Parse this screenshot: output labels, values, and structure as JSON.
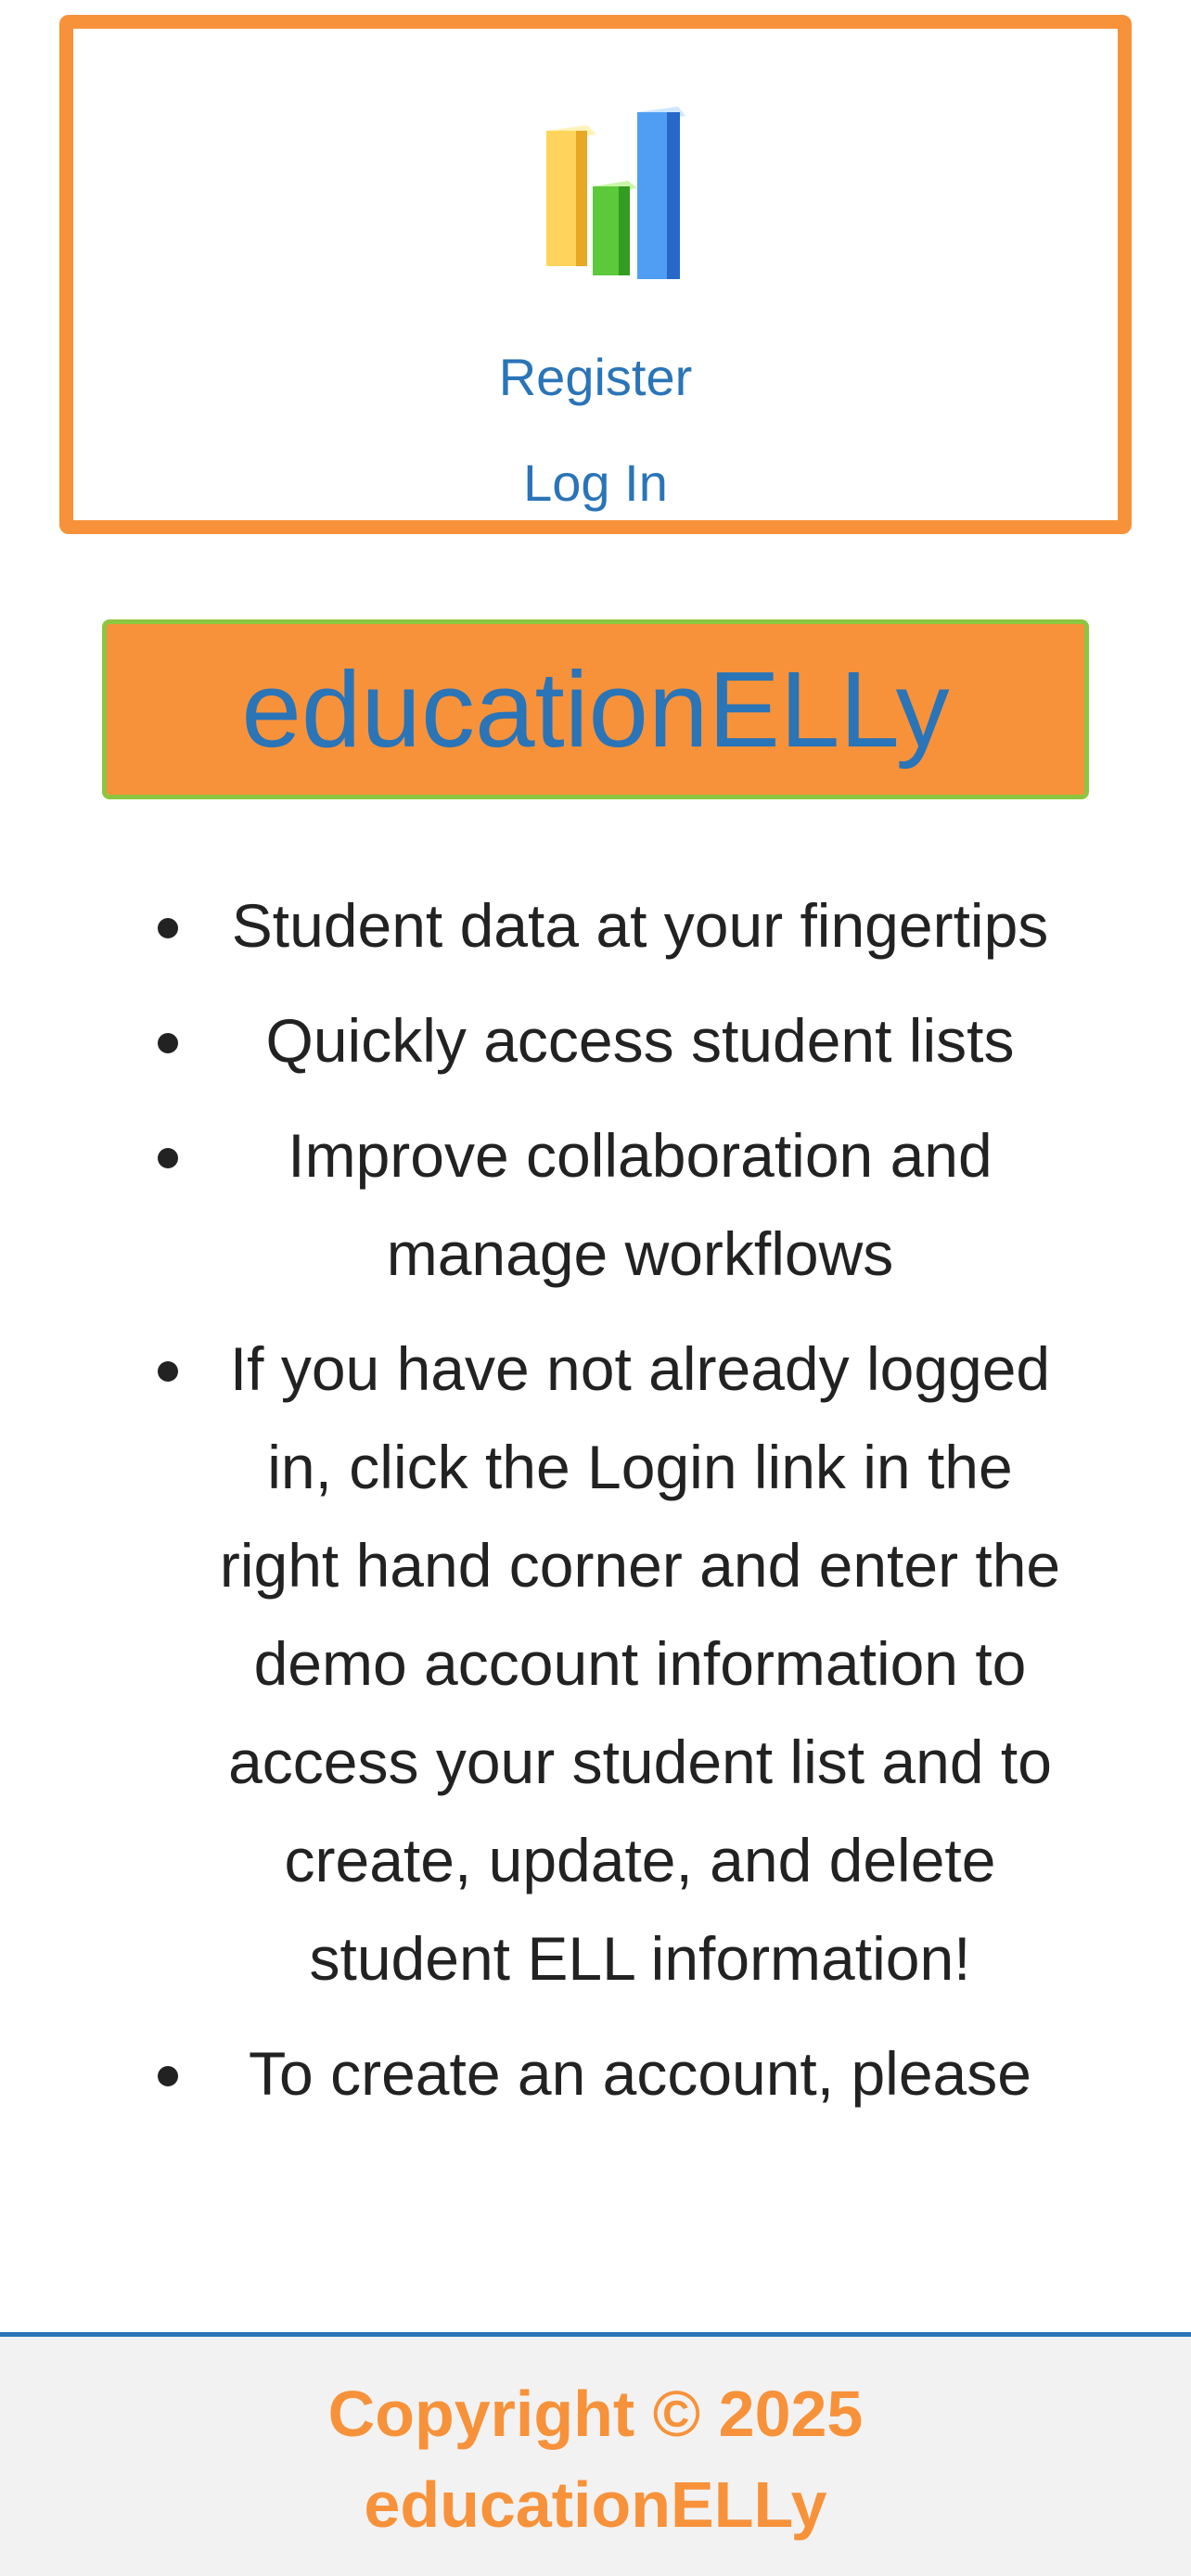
{
  "header": {
    "logo_icon": "bar-chart-icon",
    "register_label": "Register",
    "login_label": "Log In"
  },
  "title": "educationELLy",
  "features": [
    "Student data at your fingertips",
    "Quickly access student lists",
    "Improve collaboration and manage workflows",
    "If you have not already logged in, click the Login link in the right hand corner and enter the demo account information to access your student list and to create, update, and delete student ELL information!",
    "To create an account, please"
  ],
  "footer": {
    "copyright": "Copyright © 2025 educationELLy"
  },
  "colors": {
    "accent_orange": "#f7923a",
    "link_blue": "#2a74b8",
    "border_green": "#8cc63f"
  }
}
